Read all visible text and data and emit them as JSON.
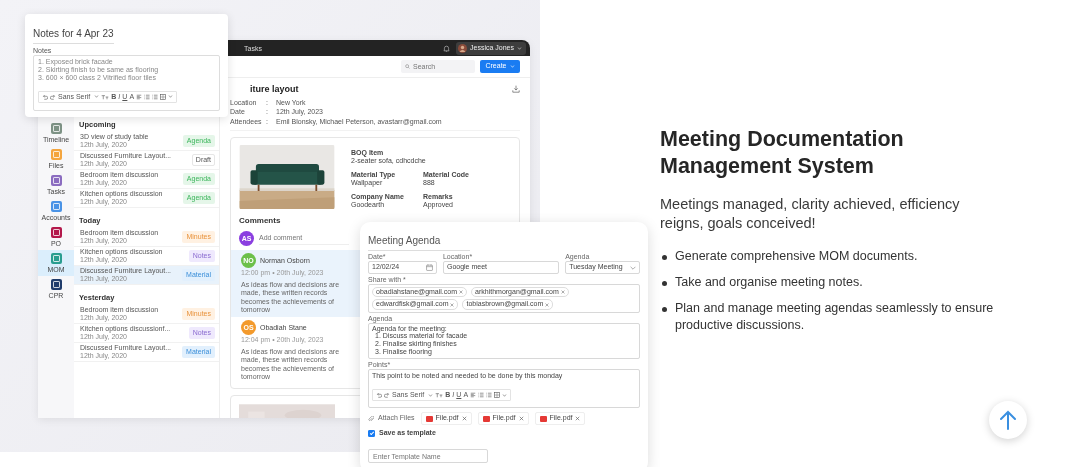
{
  "notes_card": {
    "title": "Notes for 4 Apr 23",
    "field_label": "Notes",
    "lines": [
      "1. Exposed brick facade",
      "2. Skirting finish to be same as flooring",
      "3. 600 × 600 class 2 Vitrified floor tiles"
    ],
    "toolbar": {
      "font": "Sans Serif",
      "buttons": [
        {
          "kind": "bold",
          "label": "B"
        },
        {
          "kind": "italic",
          "label": "I"
        },
        {
          "kind": "underline",
          "label": "U"
        },
        {
          "kind": "text-color",
          "label": "A"
        }
      ]
    }
  },
  "app": {
    "top_bar": {
      "title": "Tasks",
      "user": "Jessica Jones"
    },
    "search": {
      "placeholder": "Search"
    },
    "create_button": "Create",
    "nav": [
      {
        "label": "Timeline",
        "color": "#7d9285",
        "selected": false
      },
      {
        "label": "Files",
        "color": "#f4a53e",
        "selected": false
      },
      {
        "label": "Tasks",
        "color": "#8b6cc0",
        "selected": false
      },
      {
        "label": "Accounts",
        "color": "#4a93e6",
        "selected": false
      },
      {
        "label": "PO",
        "color": "#b3184b",
        "selected": false
      },
      {
        "label": "MOM",
        "color": "#2a9d90",
        "selected": true
      },
      {
        "label": "CPR",
        "color": "#1f3b6b",
        "selected": false
      }
    ],
    "groups": [
      {
        "heading": "Upcoming",
        "items": [
          {
            "title": "3D view of study table",
            "date": "12th July, 2020",
            "tag": "Agenda",
            "kind": "agenda",
            "selected": false
          },
          {
            "title": "Discussed Furniture Layout...",
            "date": "12th July, 2020",
            "tag": "Draft",
            "kind": "draft",
            "selected": false
          },
          {
            "title": "Bedroom item discussion",
            "date": "12th July, 2020",
            "tag": "Agenda",
            "kind": "agenda",
            "selected": false
          },
          {
            "title": "Kitchen options discussion",
            "date": "12th July, 2020",
            "tag": "Agenda",
            "kind": "agenda",
            "selected": false
          }
        ]
      },
      {
        "heading": "Today",
        "items": [
          {
            "title": "Bedroom item discussion",
            "date": "12th July, 2020",
            "tag": "Minutes",
            "kind": "minutes",
            "selected": false
          },
          {
            "title": "Kitchen options discussion",
            "date": "12th July, 2020",
            "tag": "Notes",
            "kind": "notes",
            "selected": false
          },
          {
            "title": "Discussed Furniture Layout...",
            "date": "12th July, 2020",
            "tag": "Material",
            "kind": "material",
            "selected": true
          }
        ]
      },
      {
        "heading": "Yesterday",
        "items": [
          {
            "title": "Bedroom item discussion",
            "date": "12th July, 2020",
            "tag": "Minutes",
            "kind": "minutes",
            "selected": false
          },
          {
            "title": "Kitchen options discussionf...",
            "date": "12th July, 2020",
            "tag": "Notes",
            "kind": "notes",
            "selected": false
          },
          {
            "title": "Discussed Furniture Layout...",
            "date": "12th July, 2020",
            "tag": "Material",
            "kind": "material",
            "selected": false
          }
        ]
      }
    ],
    "detail": {
      "title": "iture layout",
      "fields": [
        {
          "label": "Location",
          "separator": ":",
          "value": "New York"
        },
        {
          "label": "Date",
          "separator": ":",
          "value": "12th July, 2023"
        },
        {
          "label": "Attendees",
          "separator": ":",
          "value": "Emil Blonsky, Michael Peterson, avastarr@gmail.com"
        }
      ],
      "specs": [
        {
          "label": "BOQ Item",
          "value": "2-seater sofa, cdhcdche"
        },
        {
          "label": "Material Type",
          "value": "Wallpaper"
        },
        {
          "label": "Material Code",
          "value": "888"
        },
        {
          "label": "Company Name",
          "value": "Goodearth"
        },
        {
          "label": "Remarks",
          "value": "Approved"
        }
      ],
      "comments": {
        "heading": "Comments",
        "user": {
          "initials": "AS",
          "color": "#8b3fe0"
        },
        "placeholder": "Add comment",
        "items": [
          {
            "initials": "NO",
            "color": "#6cc04a",
            "author": "Norman Osborn",
            "time": "12:00 pm • 20th July, 2023",
            "text": "As ideas flow and decisions are made, these written records becomes the achievements of tomorrow",
            "highlighted": true
          },
          {
            "initials": "OS",
            "color": "#f39a2c",
            "author": "Obadiah Stane",
            "time": "12:04 pm • 20th July, 2023",
            "text": "As ideas flow and decisions are made, these written records becomes the achievements of tomorrow",
            "highlighted": false
          }
        ]
      }
    }
  },
  "agenda_card": {
    "title": "Meeting Agenda",
    "date": {
      "label": "Date*",
      "value": "12/02/24"
    },
    "location": {
      "label": "Location*",
      "value": "Google meet"
    },
    "agenda_select": {
      "label": "Agenda",
      "value": "Tuesday Meeting"
    },
    "share": {
      "label": "Share with *",
      "emails": [
        "obadiahstane@gmail.com",
        "arkhithmorgan@gmail.com",
        "edwardfisk@gmail.com",
        "tobiasbrown@gmail.com"
      ]
    },
    "agenda_text": {
      "label": "Agenda",
      "lines": [
        "Agenda for the meeting:",
        "1. Discuss material for facade",
        "2. Finalise skirting finishes",
        "3. Finalise flooring"
      ]
    },
    "points": {
      "label": "Points*",
      "value": "This point to be noted and needed to be done by this monday",
      "toolbar": {
        "font": "Sans Serif",
        "buttons": [
          {
            "kind": "bold",
            "label": "B"
          },
          {
            "kind": "italic",
            "label": "I"
          },
          {
            "kind": "underline",
            "label": "U"
          },
          {
            "kind": "text-color",
            "label": "A"
          }
        ]
      }
    },
    "attach_label": "Attach Files",
    "files": [
      "File.pdf",
      "File.pdf",
      "File.pdf"
    ],
    "save_template": {
      "label": "Save as template",
      "checked": true
    },
    "template_name": {
      "placeholder": "Enter Template Name"
    }
  },
  "hero": {
    "title": "Meeting Documentation Management System",
    "subtitle": "Meetings managed, clarity achieved, efficiency reigns, goals conceived!",
    "bullets": [
      "Generate comprehensive MOM documents.",
      "Take and organise meeting notes.",
      "Plan and manage meeting agendas seamlessly to ensure productive discussions."
    ]
  }
}
